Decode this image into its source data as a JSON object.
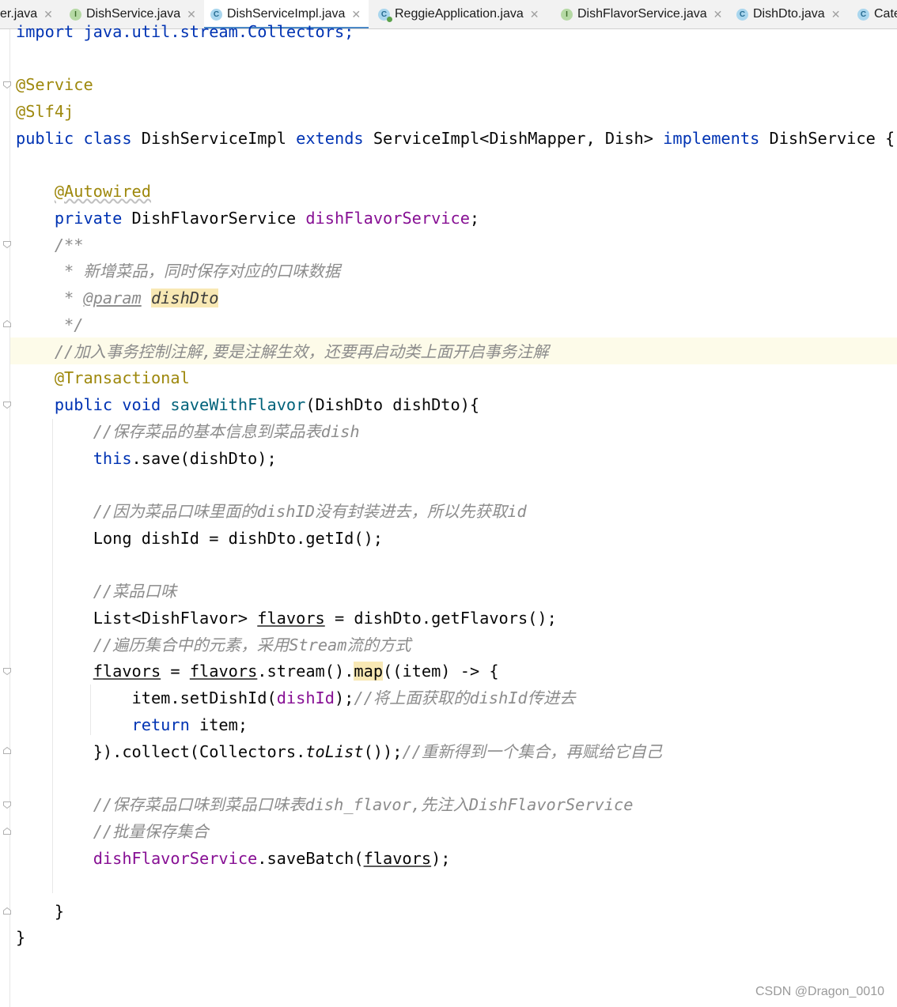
{
  "tabs": [
    {
      "label": "er.java",
      "icon": "none",
      "active": false
    },
    {
      "label": "DishService.java",
      "icon": "interface-icon",
      "active": false
    },
    {
      "label": "DishServiceImpl.java",
      "icon": "class-icon",
      "active": true
    },
    {
      "label": "ReggieApplication.java",
      "icon": "app-class-icon",
      "active": false
    },
    {
      "label": "DishFlavorService.java",
      "icon": "interface-icon",
      "active": false
    },
    {
      "label": "DishDto.java",
      "icon": "class-icon",
      "active": false
    },
    {
      "label": "Cate",
      "icon": "class-icon",
      "active": false
    }
  ],
  "code": {
    "import_line": "import java.util.stream.Collectors;",
    "ann_service": "@Service",
    "ann_slf4j": "@Slf4j",
    "class_public": "public",
    "class_kw": "class",
    "class_name": "DishServiceImpl",
    "extends_kw": "extends",
    "extends_type": "ServiceImpl<DishMapper, Dish>",
    "implements_kw": "implements",
    "implements_type": "DishService {",
    "ann_autowired": "@Autowired",
    "private_kw": "private",
    "field_type": "DishFlavorService",
    "field_name": "dishFlavorService",
    "semicolon": ";",
    "doc_open": "/**",
    "doc_desc": " * 新增菜品，同时保存对应的口味数据",
    "doc_param_star": " * ",
    "doc_param_tag": "@param",
    "doc_param_name": "dishDto",
    "doc_close": " */",
    "comment_tx": "//加入事务控制注解,要是注解生效，还要再启动类上面开启事务注解",
    "ann_transactional": "@Transactional",
    "method_public": "public",
    "method_void": "void",
    "method_name": "saveWithFlavor",
    "method_params": "(DishDto dishDto){",
    "comment_save": "//保存菜品的基本信息到菜品表dish",
    "this_kw": "this",
    "this_save": ".save(dishDto);",
    "comment_id": "//因为菜品口味里面的dishID没有封装进去，所以先获取id",
    "long_line": "Long dishId = dishDto.getId();",
    "comment_flavor": "//菜品口味",
    "list_type": "List<DishFlavor> ",
    "flavors_var": "flavors",
    "list_rest": " = dishDto.getFlavors();",
    "comment_stream": "//遍历集合中的元素，采用Stream流的方式",
    "stream_eq": " = ",
    "stream_mid": ".stream().",
    "map_word": "map",
    "stream_end": "((item) -> {",
    "set_call": "item.setDishId(",
    "dish_id_var": "dishId",
    "set_end": ");",
    "comment_set": "//将上面获取的dishId传进去",
    "return_kw": "return",
    "return_rest": " item;",
    "collect_start": "}).collect(Collectors.",
    "tolist": "toList",
    "collect_end": "());",
    "comment_collect": "//重新得到一个集合，再赋给它自己",
    "comment_batch1": "//保存菜品口味到菜品口味表dish_flavor,先注入DishFlavorService",
    "comment_batch2": "//批量保存集合",
    "batch_field": "dishFlavorService",
    "batch_call": ".saveBatch(",
    "batch_end": ");",
    "close_method": "}",
    "close_class": "}"
  },
  "watermark": "CSDN @Dragon_0010"
}
